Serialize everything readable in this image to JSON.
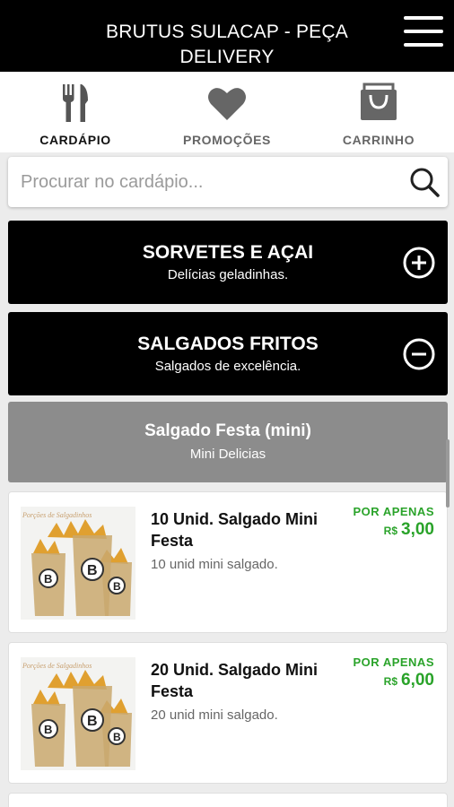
{
  "header": {
    "title": "BRUTUS SULACAP - PEÇA DELIVERY",
    "menu_icon": "hamburger-menu-icon"
  },
  "tabs": [
    {
      "label": "CARDÁPIO",
      "icon": "fork-knife-icon",
      "active": true,
      "color": "#111111"
    },
    {
      "label": "PROMOÇÕES",
      "icon": "heart-icon",
      "active": false,
      "color": "#666666"
    },
    {
      "label": "CARRINHO",
      "icon": "shopping-bag-icon",
      "active": false,
      "color": "#666666"
    }
  ],
  "search": {
    "placeholder": "Procurar no cardápio...",
    "value": "",
    "icon": "search-icon"
  },
  "categories": [
    {
      "name": "SORVETES E AÇAI",
      "description": "Delícias geladinhas.",
      "expanded": false,
      "toggle_icon": "plus-circle-icon"
    },
    {
      "name": "SALGADOS FRITOS",
      "description": "Salgados de excelência.",
      "expanded": true,
      "toggle_icon": "minus-circle-icon"
    }
  ],
  "subcategory": {
    "name": "Salgado Festa (mini)",
    "description": "Mini Delicias"
  },
  "products": [
    {
      "name": "10 Unid. Salgado Mini Festa",
      "description": "10 unid mini salgado.",
      "price_prefix": "POR APENAS",
      "currency": "R$",
      "price": "3,00",
      "image_caption": "Porções de Salgadinhos",
      "image_brand": "B"
    },
    {
      "name": "20 Unid. Salgado Mini Festa",
      "description": "20 unid mini salgado.",
      "price_prefix": "POR APENAS",
      "currency": "R$",
      "price": "6,00",
      "image_caption": "Porções de Salgadinhos",
      "image_brand": "B"
    }
  ],
  "colors": {
    "header_bg": "#000000",
    "category_bg": "#000000",
    "subcategory_bg": "#8c8c8c",
    "price_green": "#2aa32a"
  }
}
